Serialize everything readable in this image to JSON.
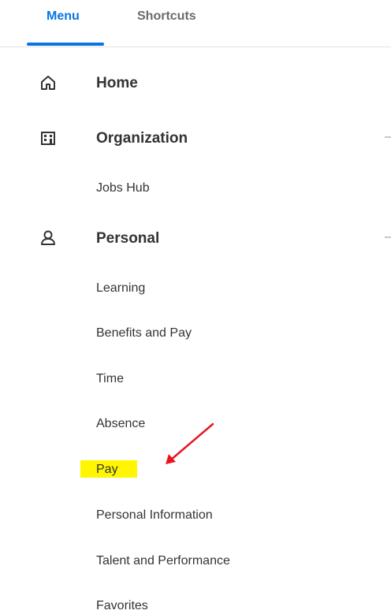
{
  "tabs": {
    "menu": "Menu",
    "shortcuts": "Shortcuts"
  },
  "nav": {
    "home": "Home",
    "organization": "Organization",
    "jobs_hub": "Jobs Hub",
    "personal": "Personal",
    "items": [
      "Learning",
      "Benefits and Pay",
      "Time",
      "Absence",
      "Pay",
      "Personal Information",
      "Talent and Performance",
      "Favorites"
    ]
  },
  "icons": {
    "home": "home-icon",
    "organization": "building-icon",
    "personal": "person-icon"
  },
  "colors": {
    "accent": "#0875e1",
    "highlight": "#fff600",
    "annotation_arrow": "#e8141f"
  }
}
